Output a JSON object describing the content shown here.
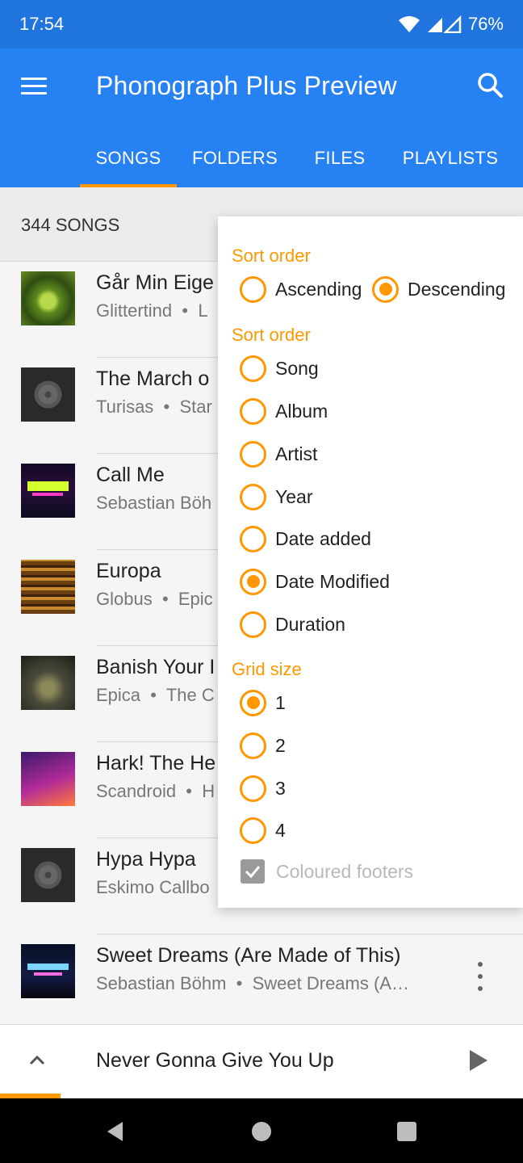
{
  "status": {
    "time": "17:54",
    "battery": "76%"
  },
  "app": {
    "title": "Phonograph Plus Preview"
  },
  "tabs": [
    {
      "label": "SONGS",
      "active": true
    },
    {
      "label": "FOLDERS",
      "active": false
    },
    {
      "label": "FILES",
      "active": false
    },
    {
      "label": "PLAYLISTS",
      "active": false
    }
  ],
  "list_header": {
    "count": "344 SONGS"
  },
  "songs": [
    {
      "title": "Går Min Eige",
      "artist": "Glittertind",
      "album": "L",
      "art": "green"
    },
    {
      "title": "The March o",
      "artist": "Turisas",
      "album": "Star",
      "art": "record"
    },
    {
      "title": "Call Me",
      "artist": "Sebastian Böh",
      "album": "",
      "art": "neon"
    },
    {
      "title": "Europa",
      "artist": "Globus",
      "album": "Epic",
      "art": "gold"
    },
    {
      "title": "Banish Your I",
      "artist": "Epica",
      "album": "The C",
      "art": "epica"
    },
    {
      "title": "Hark! The He",
      "artist": "Scandroid",
      "album": "H",
      "art": "angels"
    },
    {
      "title": "Hypa Hypa",
      "artist": "Eskimo Callbo",
      "album": "",
      "art": "record"
    },
    {
      "title": "Sweet Dreams (Are Made of This)",
      "artist": "Sebastian Böhm",
      "album": "Sweet Dreams (A…",
      "art": "sweet"
    }
  ],
  "sort_popup": {
    "section_order_direction": "Sort order",
    "direction_options": [
      {
        "label": "Ascending",
        "checked": false
      },
      {
        "label": "Descending",
        "checked": true
      }
    ],
    "section_order_by": "Sort order",
    "order_options": [
      {
        "label": "Song",
        "checked": false
      },
      {
        "label": "Album",
        "checked": false
      },
      {
        "label": "Artist",
        "checked": false
      },
      {
        "label": "Year",
        "checked": false
      },
      {
        "label": "Date added",
        "checked": false
      },
      {
        "label": "Date Modified",
        "checked": true
      },
      {
        "label": "Duration",
        "checked": false
      }
    ],
    "section_grid": "Grid size",
    "grid_options": [
      {
        "label": "1",
        "checked": true
      },
      {
        "label": "2",
        "checked": false
      },
      {
        "label": "3",
        "checked": false
      },
      {
        "label": "4",
        "checked": false
      }
    ],
    "coloured_footers": {
      "label": "Coloured footers",
      "checked": true,
      "enabled": false
    }
  },
  "now_playing": {
    "track": "Never Gonna Give You Up",
    "progress_fraction": 0.115
  },
  "colors": {
    "primary": "#2681f2",
    "status": "#1f74dd",
    "accent": "#ff9800"
  }
}
